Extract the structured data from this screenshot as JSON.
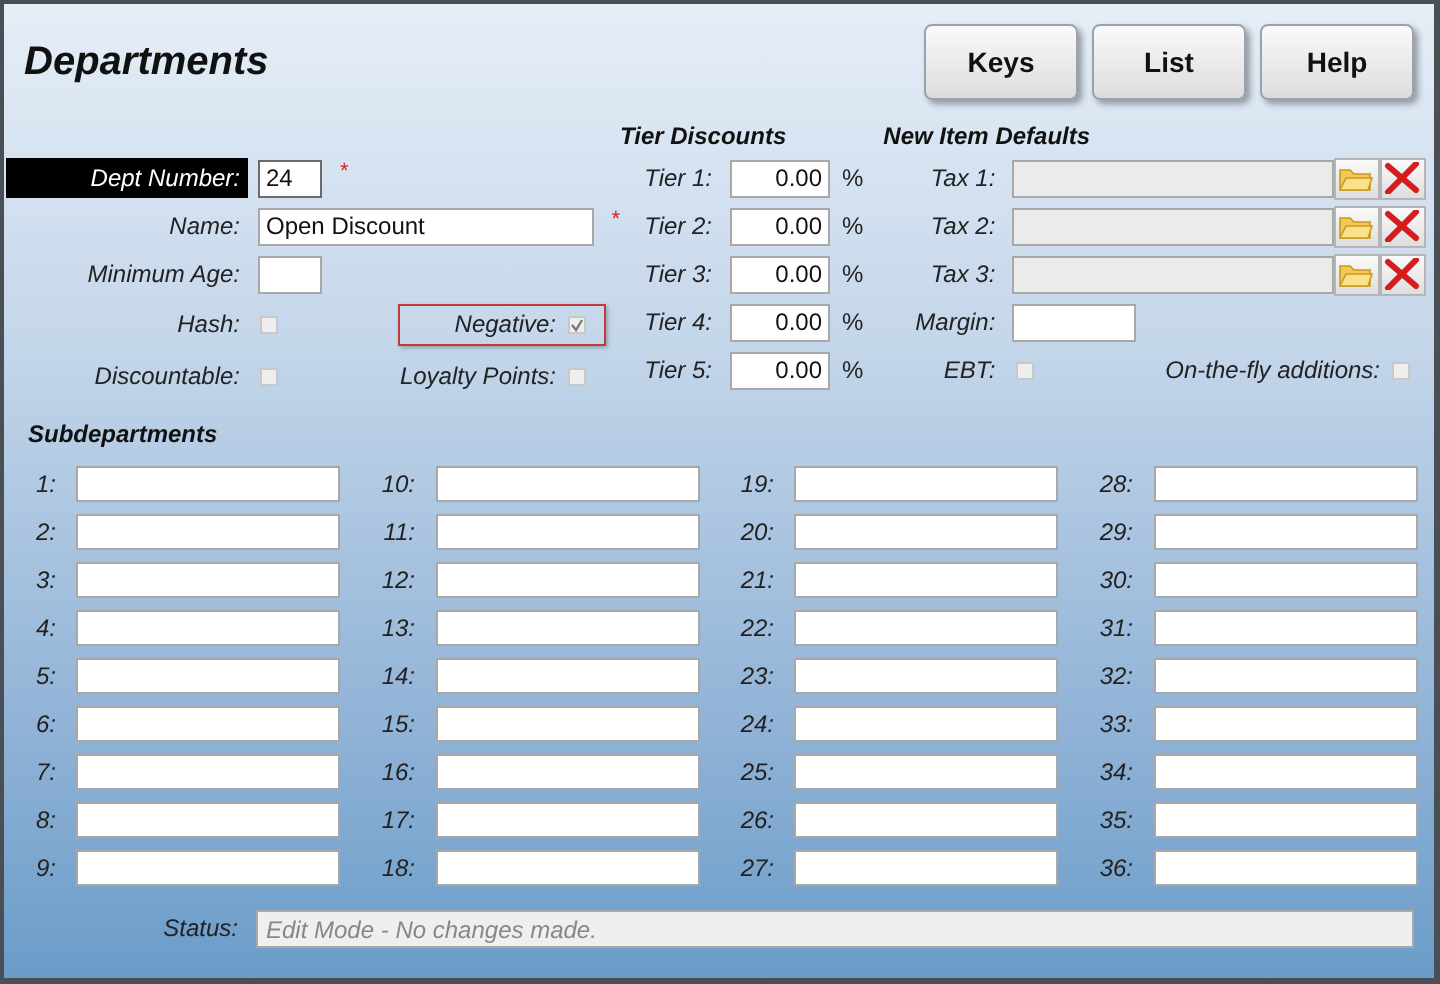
{
  "title": "Departments",
  "buttons": [
    {
      "label": "Keys"
    },
    {
      "label": "List"
    },
    {
      "label": "Help"
    }
  ],
  "general": {
    "dept_number": {
      "label": "Dept Number:",
      "value": "24",
      "required_mark": "*",
      "focused": true
    },
    "name": {
      "label": "Name:",
      "value": "Open Discount",
      "required_mark": "*"
    },
    "minimum_age": {
      "label": "Minimum Age:"
    },
    "flag_rows": [
      {
        "left": {
          "label": "Hash:",
          "checked": false
        },
        "right": {
          "label": "Negative:",
          "checked": true,
          "highlighted": true
        }
      },
      {
        "left": {
          "label": "Discountable:",
          "checked": false
        },
        "right": {
          "label": "Loyalty Points:",
          "checked": false,
          "highlighted": false
        }
      }
    ]
  },
  "tier_discounts": {
    "heading": "Tier Discounts",
    "rows": [
      {
        "label": "Tier 1:",
        "value": "0.00",
        "unit": "%"
      },
      {
        "label": "Tier 2:",
        "value": "0.00",
        "unit": "%"
      },
      {
        "label": "Tier 3:",
        "value": "0.00",
        "unit": "%"
      },
      {
        "label": "Tier 4:",
        "value": "0.00",
        "unit": "%"
      },
      {
        "label": "Tier 5:",
        "value": "0.00",
        "unit": "%"
      }
    ]
  },
  "new_item_defaults": {
    "heading": "New Item Defaults",
    "taxes": [
      {
        "label": "Tax 1:"
      },
      {
        "label": "Tax 2:"
      },
      {
        "label": "Tax 3:"
      }
    ],
    "margin": {
      "label": "Margin:"
    },
    "ebt": {
      "label": "EBT:",
      "checked": false
    },
    "on_the_fly": {
      "label": "On-the-fly additions:",
      "checked": false
    }
  },
  "subdepartments": {
    "heading": "Subdepartments",
    "items": [
      {
        "label": "1:"
      },
      {
        "label": "2:"
      },
      {
        "label": "3:"
      },
      {
        "label": "4:"
      },
      {
        "label": "5:"
      },
      {
        "label": "6:"
      },
      {
        "label": "7:"
      },
      {
        "label": "8:"
      },
      {
        "label": "9:"
      },
      {
        "label": "10:"
      },
      {
        "label": "11:"
      },
      {
        "label": "12:"
      },
      {
        "label": "13:"
      },
      {
        "label": "14:"
      },
      {
        "label": "15:"
      },
      {
        "label": "16:"
      },
      {
        "label": "17:"
      },
      {
        "label": "18:"
      },
      {
        "label": "19:"
      },
      {
        "label": "20:"
      },
      {
        "label": "21:"
      },
      {
        "label": "22:"
      },
      {
        "label": "23:"
      },
      {
        "label": "24:"
      },
      {
        "label": "25:"
      },
      {
        "label": "26:"
      },
      {
        "label": "27:"
      },
      {
        "label": "28:"
      },
      {
        "label": "29:"
      },
      {
        "label": "30:"
      },
      {
        "label": "31:"
      },
      {
        "label": "32:"
      },
      {
        "label": "33:"
      },
      {
        "label": "34:"
      },
      {
        "label": "35:"
      },
      {
        "label": "36:"
      }
    ]
  },
  "status": {
    "label": "Status:",
    "value": "Edit Mode - No changes made."
  }
}
